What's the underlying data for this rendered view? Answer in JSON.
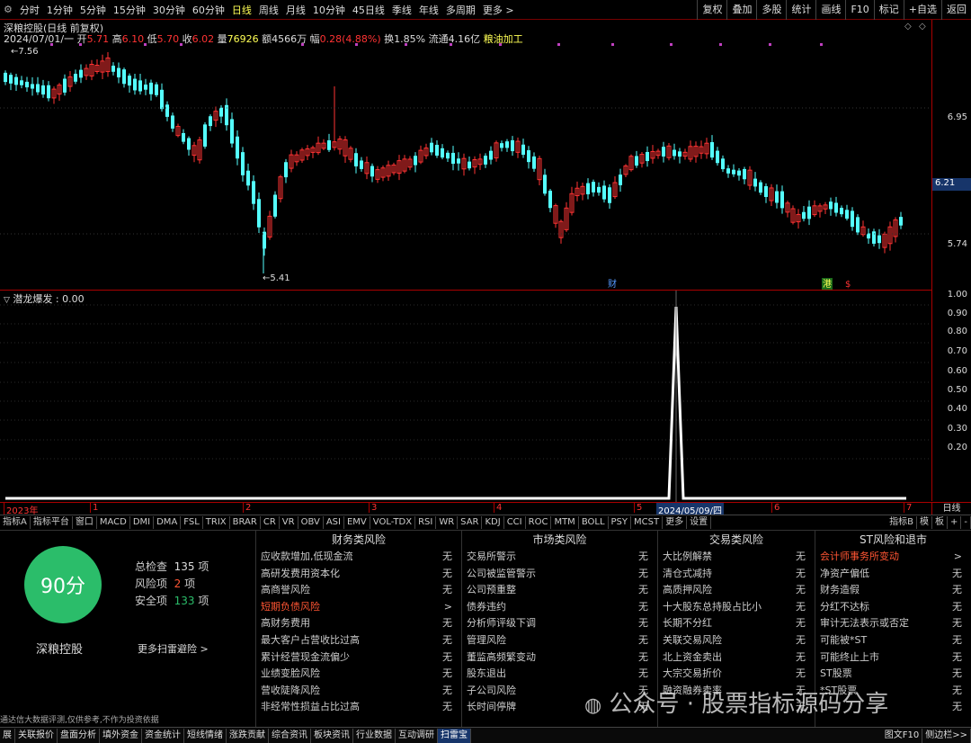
{
  "toolbar": {
    "items": [
      "分时",
      "1分钟",
      "5分钟",
      "15分钟",
      "30分钟",
      "60分钟",
      "日线",
      "周线",
      "月线",
      "10分钟",
      "45日线",
      "季线",
      "年线",
      "多周期",
      "更多 >"
    ],
    "active_index": 6,
    "right": [
      "复权",
      "叠加",
      "多股",
      "统计",
      "画线",
      "F10",
      "标记",
      "+自选",
      "返回"
    ]
  },
  "stock": {
    "title": "深粮控股(日线 前复权)",
    "date": "2024/07/01/一",
    "open_label": "开",
    "open": "5.71",
    "high_label": "高",
    "high": "6.10",
    "low_label": "低",
    "low": "5.70",
    "close_label": "收",
    "close": "6.02",
    "vol_label": "量",
    "vol": "76926",
    "amount_label": "额",
    "amount": "4566万",
    "change_label": "幅",
    "change": "0.28(4.88%)",
    "turnover_label": "换",
    "turnover": "1.85%",
    "float_label": "流通",
    "float": "4.16亿",
    "industry": "粮油加工"
  },
  "price_axis": {
    "ticks": [
      "6.95",
      "6.21",
      "5.74"
    ],
    "current": "6.21"
  },
  "annotations": {
    "high": "7.56",
    "low": "5.41",
    "cai": "财",
    "gang": "港",
    "dollar": "$"
  },
  "indicator": {
    "title": "潜龙爆发 : 0.00",
    "ticks": [
      "1.00",
      "0.90",
      "0.80",
      "0.70",
      "0.60",
      "0.50",
      "0.40",
      "0.30",
      "0.20"
    ]
  },
  "date_axis": {
    "labels": [
      "2023年",
      "1",
      "2",
      "3",
      "4",
      "5",
      "6",
      "7"
    ],
    "cursor": "2024/05/09/四",
    "right": "日线"
  },
  "tabs": [
    "指标A",
    "指标平台",
    "窗口",
    "MACD",
    "DMI",
    "DMA",
    "FSL",
    "TRIX",
    "BRAR",
    "CR",
    "VR",
    "OBV",
    "ASI",
    "EMV",
    "VOL-TDX",
    "RSI",
    "WR",
    "SAR",
    "KDJ",
    "CCI",
    "ROC",
    "MTM",
    "BOLL",
    "PSY",
    "MCST",
    "更多",
    "设置"
  ],
  "tabs_right": [
    "指标B",
    "模",
    "板",
    "+",
    "-"
  ],
  "score": {
    "value": "90分",
    "name": "深粮控股",
    "total_label": "总检查",
    "total": "135",
    "unit": "项",
    "risk_label": "风险项",
    "risk": "2",
    "safe_label": "安全项",
    "safe": "133",
    "more": "更多扫雷避险 >",
    "color": "#2bbd6a"
  },
  "risk_columns": [
    {
      "title": "财务类风险",
      "rows": [
        {
          "label": "应收款增加,低现金流",
          "value": "无"
        },
        {
          "label": "高研发费用资本化",
          "value": "无"
        },
        {
          "label": "高商誉风险",
          "value": "无"
        },
        {
          "label": "短期负债风险",
          "value": ">",
          "alert": true
        },
        {
          "label": "高财务费用",
          "value": "无"
        },
        {
          "label": "最大客户占营收比过高",
          "value": "无"
        },
        {
          "label": "累计经营现金流偏少",
          "value": "无"
        },
        {
          "label": "业绩变脸风险",
          "value": "无"
        },
        {
          "label": "营收陡降风险",
          "value": "无"
        },
        {
          "label": "非经常性损益占比过高",
          "value": "无"
        }
      ]
    },
    {
      "title": "市场类风险",
      "rows": [
        {
          "label": "交易所警示",
          "value": "无"
        },
        {
          "label": "公司被监管警示",
          "value": "无"
        },
        {
          "label": "公司预重整",
          "value": "无"
        },
        {
          "label": "债券违约",
          "value": "无"
        },
        {
          "label": "分析师评级下调",
          "value": "无"
        },
        {
          "label": "管理风险",
          "value": "无"
        },
        {
          "label": "董监高频繁变动",
          "value": "无"
        },
        {
          "label": "股东退出",
          "value": "无"
        },
        {
          "label": "子公司风险",
          "value": "无"
        },
        {
          "label": "长时间停牌",
          "value": "无"
        }
      ]
    },
    {
      "title": "交易类风险",
      "rows": [
        {
          "label": "大比例解禁",
          "value": "无"
        },
        {
          "label": "清仓式减持",
          "value": "无"
        },
        {
          "label": "高质押风险",
          "value": "无"
        },
        {
          "label": "十大股东总持股占比小",
          "value": "无"
        },
        {
          "label": "长期不分红",
          "value": "无"
        },
        {
          "label": "关联交易风险",
          "value": "无"
        },
        {
          "label": "北上资金卖出",
          "value": "无"
        },
        {
          "label": "大宗交易折价",
          "value": "无"
        },
        {
          "label": "融资融券卖率",
          "value": "无"
        },
        {
          "label": "",
          "value": "无"
        }
      ]
    },
    {
      "title": "ST风险和退市",
      "rows": [
        {
          "label": "会计师事务所变动",
          "value": ">",
          "alert": true
        },
        {
          "label": "净资产偏低",
          "value": "无"
        },
        {
          "label": "财务造假",
          "value": "无"
        },
        {
          "label": "分红不达标",
          "value": "无"
        },
        {
          "label": "审计无法表示或否定",
          "value": "无"
        },
        {
          "label": "可能被*ST",
          "value": "无"
        },
        {
          "label": "可能终止上市",
          "value": "无"
        },
        {
          "label": "ST股票",
          "value": "无"
        },
        {
          "label": "*ST股票",
          "value": "无"
        },
        {
          "label": "",
          "value": "无"
        }
      ]
    }
  ],
  "disclaimer": "通达信大数据评测,仅供参考,不作为投资依据",
  "watermark": "公众号 · 股票指标源码分享",
  "status": [
    "展",
    "关联报价",
    "盘面分析",
    "填外资金",
    "资金统计",
    "短线情绪",
    "涨跌贡献",
    "综合资讯",
    "板块资讯",
    "行业数据",
    "互动调研",
    "扫雷宝"
  ],
  "status_active_index": 11,
  "status_right": [
    "图文F10",
    "侧边栏>>"
  ],
  "colors": {
    "up": "#ff3333",
    "down": "#54ffff",
    "alert": "#ff5533",
    "axis": "#aa0000",
    "active_tab": "#17356a"
  }
}
